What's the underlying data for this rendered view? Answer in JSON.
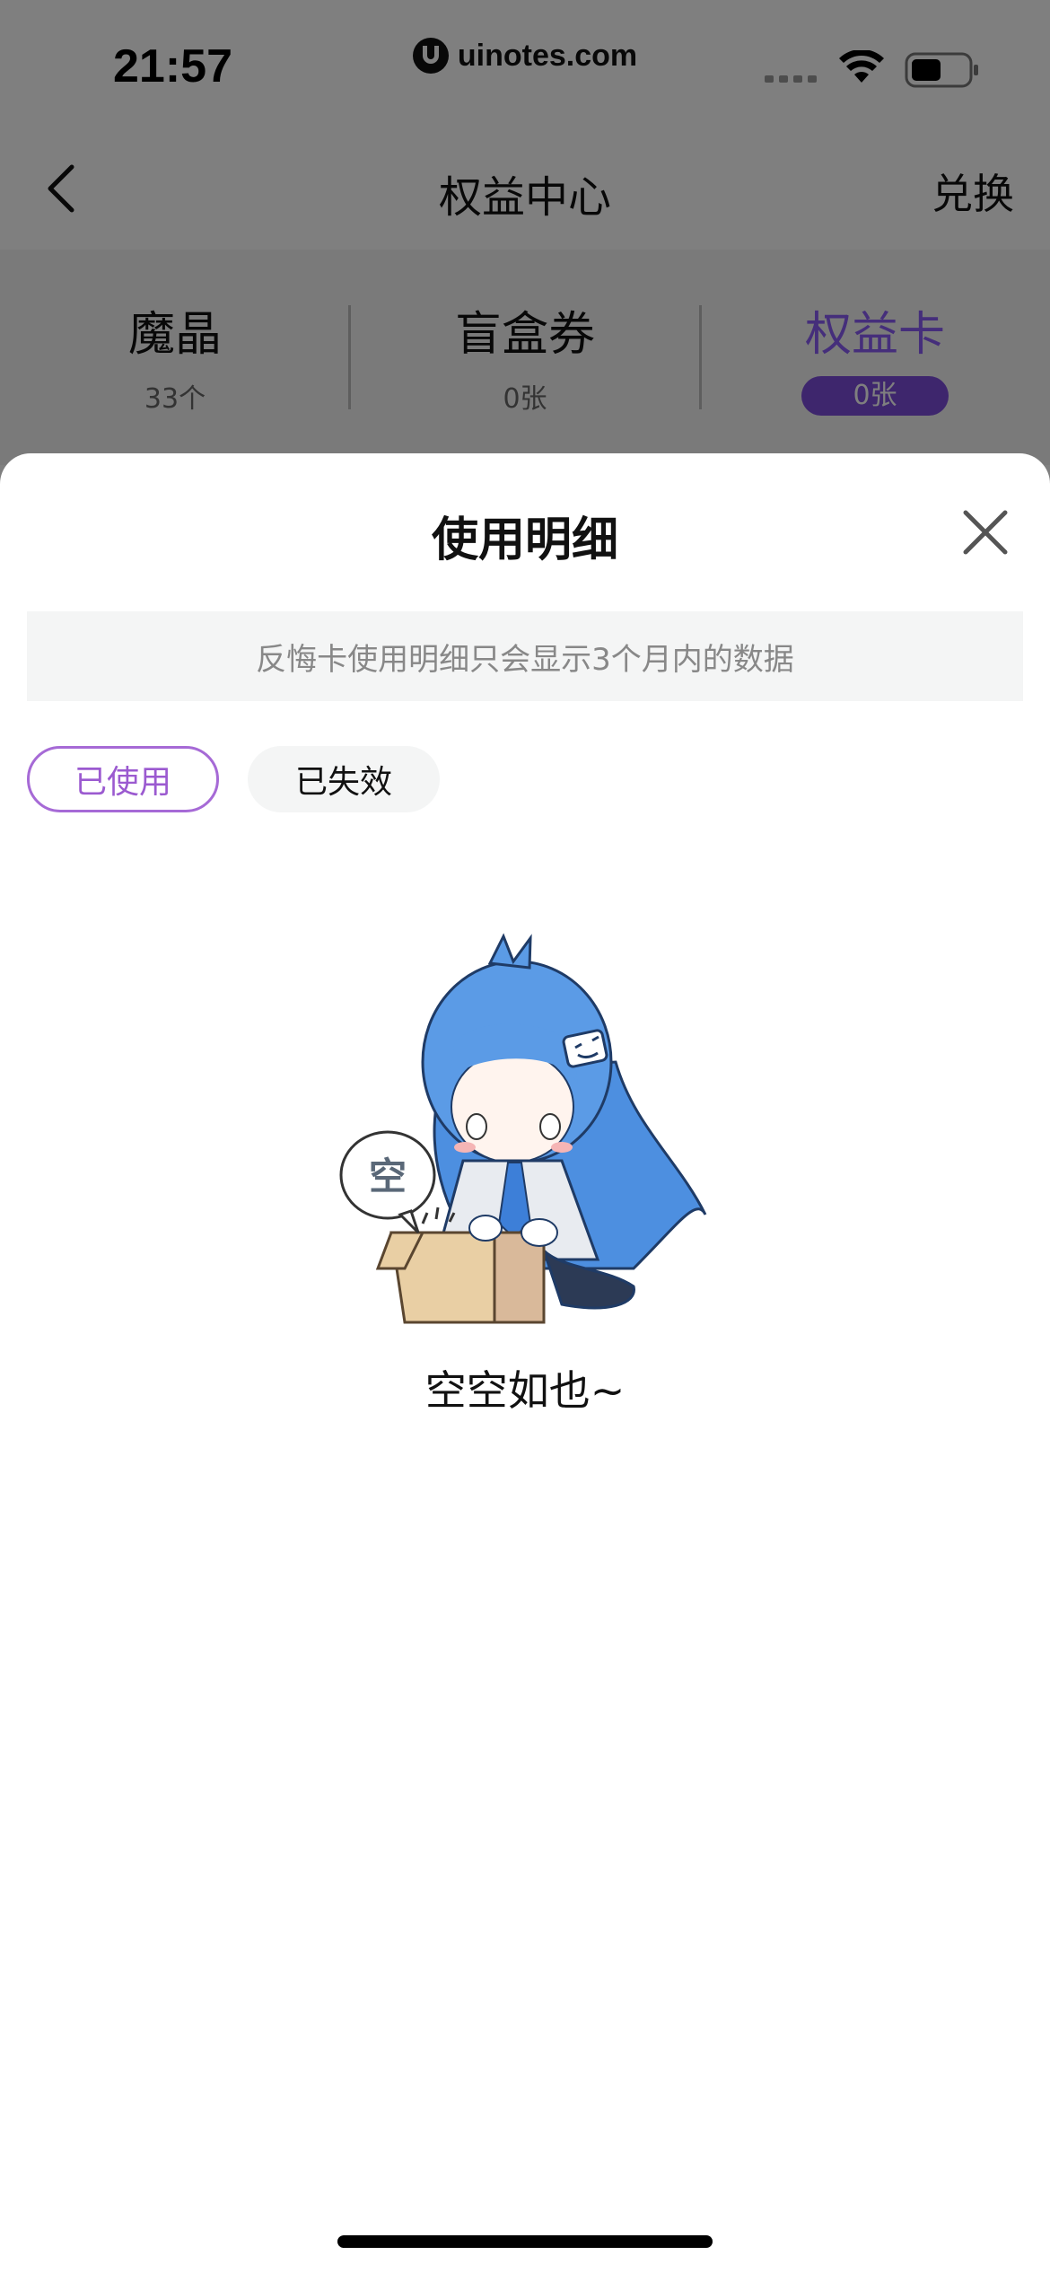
{
  "status_bar": {
    "time": "21:57",
    "url": "uinotes.com"
  },
  "nav": {
    "title": "权益中心",
    "right_action": "兑换",
    "back_icon": "chevron-left-icon"
  },
  "tabs": [
    {
      "label": "魔晶",
      "count": "33个",
      "active": false
    },
    {
      "label": "盲盒券",
      "count": "0张",
      "active": false
    },
    {
      "label": "权益卡",
      "count": "0张",
      "active": true
    }
  ],
  "sheet": {
    "title": "使用明细",
    "close_icon": "close-icon",
    "notice": "反悔卡使用明细只会显示3个月内的数据",
    "filters": [
      {
        "label": "已使用",
        "selected": true
      },
      {
        "label": "已失效",
        "selected": false
      }
    ],
    "empty": {
      "bubble_text": "空",
      "message": "空空如也~"
    }
  },
  "colors": {
    "accent": "#8b5cf6",
    "pill": "#7c4ddb",
    "chip_border": "#a66ad6"
  }
}
